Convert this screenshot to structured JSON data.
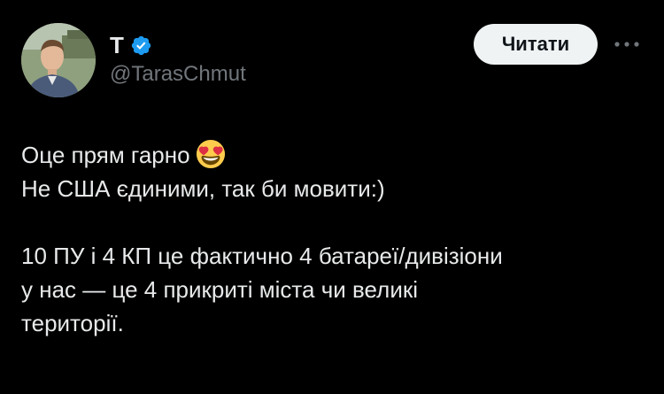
{
  "author": {
    "display_name": "T",
    "handle": "@TarasChmut",
    "verified": true,
    "avatar_icon": "profile-photo"
  },
  "actions": {
    "follow_label": "Читати",
    "more_icon": "more-horizontal-icon"
  },
  "tweet": {
    "line1_text": "Оце прям гарно",
    "line1_emoji": "smiling-face-with-heart-eyes",
    "line2": "Не США єдиними, так би мовити:)",
    "line3": "10 ПУ і 4 КП це фактично 4 батареї/дивізіони",
    "line4": "у нас — це 4 прикриті міста чи великі",
    "line5": "території."
  },
  "colors": {
    "background": "#000000",
    "text_primary": "#e7e9ea",
    "text_secondary": "#71767b",
    "verified_badge": "#1d9bf0",
    "follow_button_bg": "#eff3f4"
  }
}
